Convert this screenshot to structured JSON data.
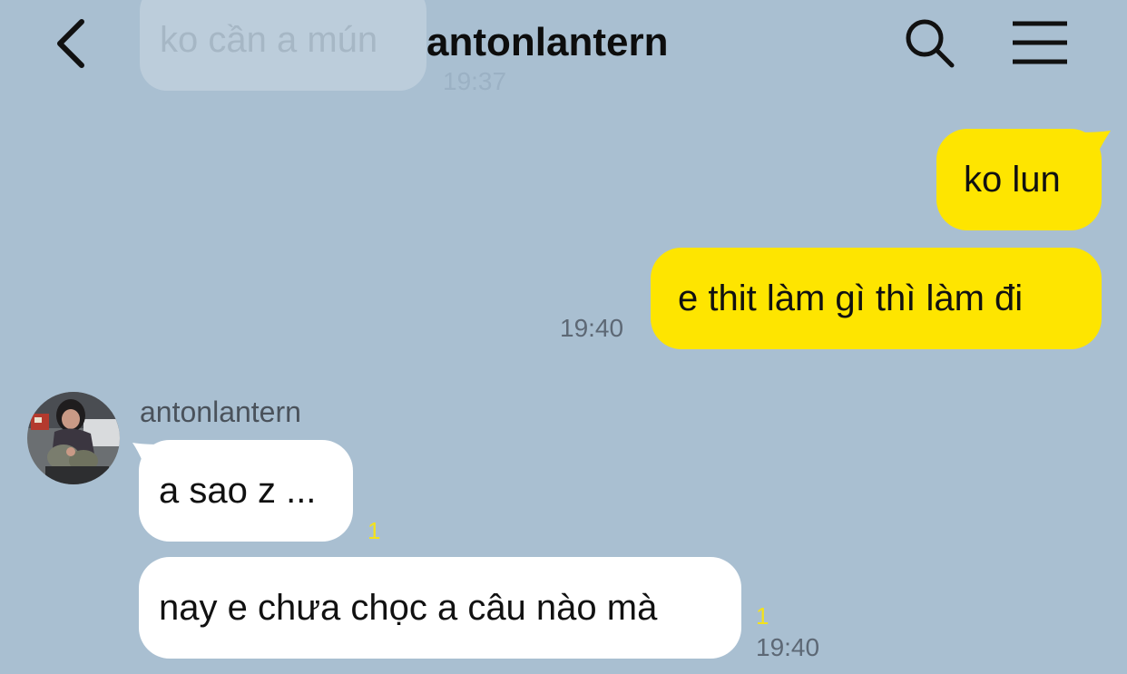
{
  "header": {
    "title": "antonlantern",
    "back_icon": "chevron-left-icon",
    "search_icon": "search-icon",
    "menu_icon": "hamburger-menu-icon"
  },
  "previous_message": {
    "text": "ko cần a mún",
    "time": "19:37"
  },
  "messages": [
    {
      "direction": "outgoing",
      "text": "ko lun"
    },
    {
      "direction": "outgoing",
      "text": "e thit làm gì thì làm đi",
      "time": "19:40"
    },
    {
      "direction": "incoming",
      "sender": "antonlantern",
      "text": "a sao z ...",
      "unread": "1"
    },
    {
      "direction": "incoming",
      "text": "nay e chưa chọc a câu nào mà",
      "unread": "1",
      "time": "19:40"
    }
  ],
  "colors": {
    "background": "#a9bfd1",
    "outgoing_bubble": "#fee500",
    "incoming_bubble": "#ffffff",
    "unread_count": "#f4e21a"
  }
}
